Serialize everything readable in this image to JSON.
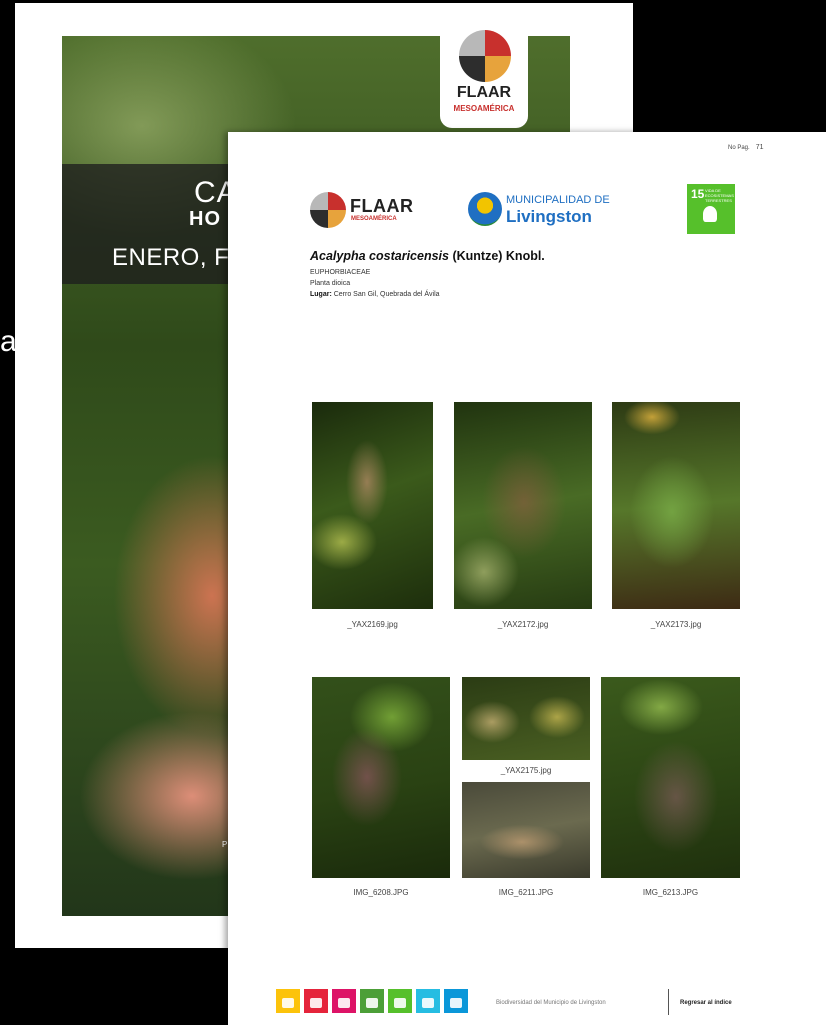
{
  "cover": {
    "title_1": "CA",
    "title_2": "HO",
    "title_3": "ENERO, F",
    "logo_name": "FLAAR",
    "logo_sub": "MESOAMÉRICA",
    "credit": "P",
    "stray_letter": "a"
  },
  "page": {
    "page_label": "No Pag.",
    "page_number": "71",
    "flaar_name": "FLAAR",
    "flaar_sub": "MESOAMÉRICA",
    "muni_line1": "MUNICIPALIDAD DE",
    "muni_line2": "Livingston",
    "sdg15_number": "15",
    "sdg15_text": "VIDA DE ECOSISTEMAS TERRESTRES",
    "species_name": "Acalypha costaricensis",
    "species_author": " (Kuntze) Knobl.",
    "family": "EUPHORBIACEAE",
    "plant_type": "Planta dioica",
    "place_label": "Lugar:",
    "place_value": " Cerro San Gil, Quebrada del Ávila",
    "photos": [
      {
        "caption": "_YAX2169.jpg"
      },
      {
        "caption": "_YAX2172.jpg"
      },
      {
        "caption": "_YAX2173.jpg"
      },
      {
        "caption": "IMG_6208.JPG"
      },
      {
        "caption": "_YAX2175.jpg"
      },
      {
        "caption": "IMG_6211.JPG"
      },
      {
        "caption": "IMG_6213.JPG"
      }
    ],
    "footer_text": "Biodiversidad del Municipio de Livingston",
    "footer_link": "Regresar al índice",
    "sdg_colors": [
      "#fcc30b",
      "#e5243b",
      "#dd1367",
      "#4c9f38",
      "#56c02b",
      "#26bde2",
      "#0a97d9"
    ]
  }
}
